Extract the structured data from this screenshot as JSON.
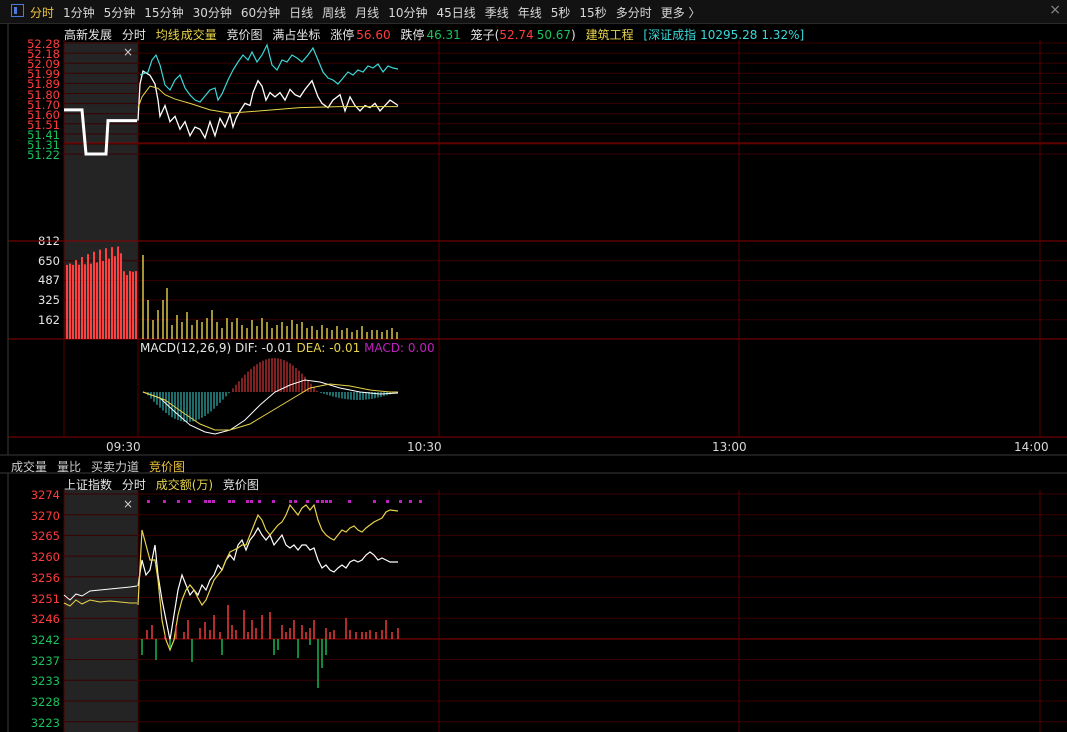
{
  "toolbar": {
    "periods": [
      "分时",
      "1分钟",
      "5分钟",
      "15分钟",
      "30分钟",
      "60分钟",
      "日线",
      "周线",
      "月线",
      "10分钟",
      "45日线",
      "季线",
      "年线",
      "5秒",
      "15秒",
      "多分时",
      "更多 〉"
    ],
    "active_index": 0
  },
  "top_chart": {
    "header": {
      "name": "高新发展",
      "mode": "分时",
      "avg_label": "均线",
      "volume_label": "成交量",
      "auction_label": "竞价图",
      "fullscreen_label": "满占坐标",
      "limit_up_label": "涨停",
      "limit_up": "56.60",
      "limit_down_label": "跌停",
      "limit_down": "46.31",
      "cage_label": "笼子(",
      "cage_high": "52.74",
      "cage_low": "50.67",
      "cage_close": ")",
      "sector": "建筑工程",
      "index_text": "[深证成指",
      "index_value": "10295.28",
      "index_change": "1.32%]"
    },
    "price_axis": {
      "red": [
        "52.28",
        "52.18",
        "52.09",
        "51.99",
        "51.89",
        "51.80",
        "51.70",
        "51.60",
        "51.51"
      ],
      "green": [
        "51.41",
        "51.31",
        "51.22"
      ]
    },
    "volume_axis": [
      "812",
      "650",
      "487",
      "325",
      "162"
    ],
    "macd": {
      "label": "MACD(12,26,9)",
      "dif_label": "DIF:",
      "dif": "-0.01",
      "dea_label": "DEA:",
      "dea": "-0.01",
      "macd_label": "MACD:",
      "macd_value": "0.00"
    },
    "time_axis": [
      "09:30",
      "10:30",
      "13:00",
      "14:00"
    ],
    "colors": {
      "up": "#ff3b3b",
      "down": "#19c35a",
      "price": "#ffffff",
      "avg": "#e8d34a",
      "index": "#3ad8d8",
      "macd": "#c020c0",
      "grid": "#5a0000"
    }
  },
  "bottom_tabs": {
    "items": [
      "成交量",
      "量比",
      "买卖力道",
      "竞价图"
    ],
    "active_index": 3
  },
  "bottom_chart": {
    "header": {
      "name": "上证指数",
      "mode": "分时",
      "amount_label": "成交额(万)",
      "auction_label": "竞价图"
    },
    "price_axis": {
      "red": [
        "3274",
        "3270",
        "3265",
        "3260",
        "3256",
        "3251",
        "3246"
      ],
      "green": [
        "3242",
        "3237",
        "3233",
        "3228",
        "3223"
      ]
    }
  }
}
